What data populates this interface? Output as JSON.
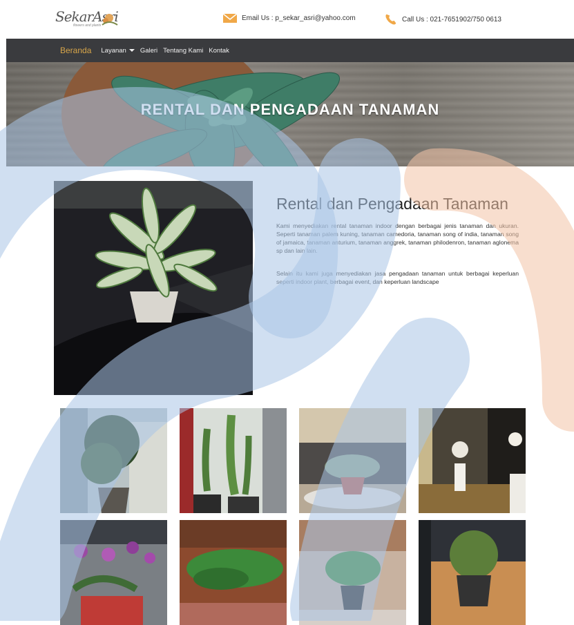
{
  "header": {
    "logo_text": "SekarAsri",
    "logo_tagline": "flowers and plants",
    "email": "Email Us : p_sekar_asri@yahoo.com",
    "phone": "Call Us : 021-7651902/750 0613"
  },
  "nav": {
    "items": [
      {
        "label": "Beranda",
        "active": true
      },
      {
        "label": "Layanan",
        "dropdown": true
      },
      {
        "label": "Galeri"
      },
      {
        "label": "Tentang Kami"
      },
      {
        "label": "Kontak"
      }
    ]
  },
  "hero": {
    "title": "RENTAL DAN PENGADAAN TANAMAN"
  },
  "content": {
    "heading": "Rental dan Pengadaan Tanaman",
    "paragraph1": "Kami menyediakan rental tanaman indoor dengan berbagai jenis tanaman dan ukuran. Seperti tanaman palem kuning, tanaman camedoria, tanaman song of india, tanaman song of jamaica, tanaman anturium, tanaman anggrek, tanaman philodenron, tanaman aglonema sp dan lain lain.",
    "paragraph2": "Selain itu kami juga menyediakan jasa pengadaan tanaman untuk berbagai keperluan seperti indoor plant, berbagai event, dan keperluan landscape"
  },
  "colors": {
    "nav_bg": "#3a3b3e",
    "nav_active": "#d8a64a",
    "watermark_blue": "#a9c4e6",
    "watermark_peach": "#f3c3a6",
    "icon_orange": "#f0a848"
  },
  "icons": {
    "email": "envelope-icon",
    "phone": "phone-icon"
  }
}
